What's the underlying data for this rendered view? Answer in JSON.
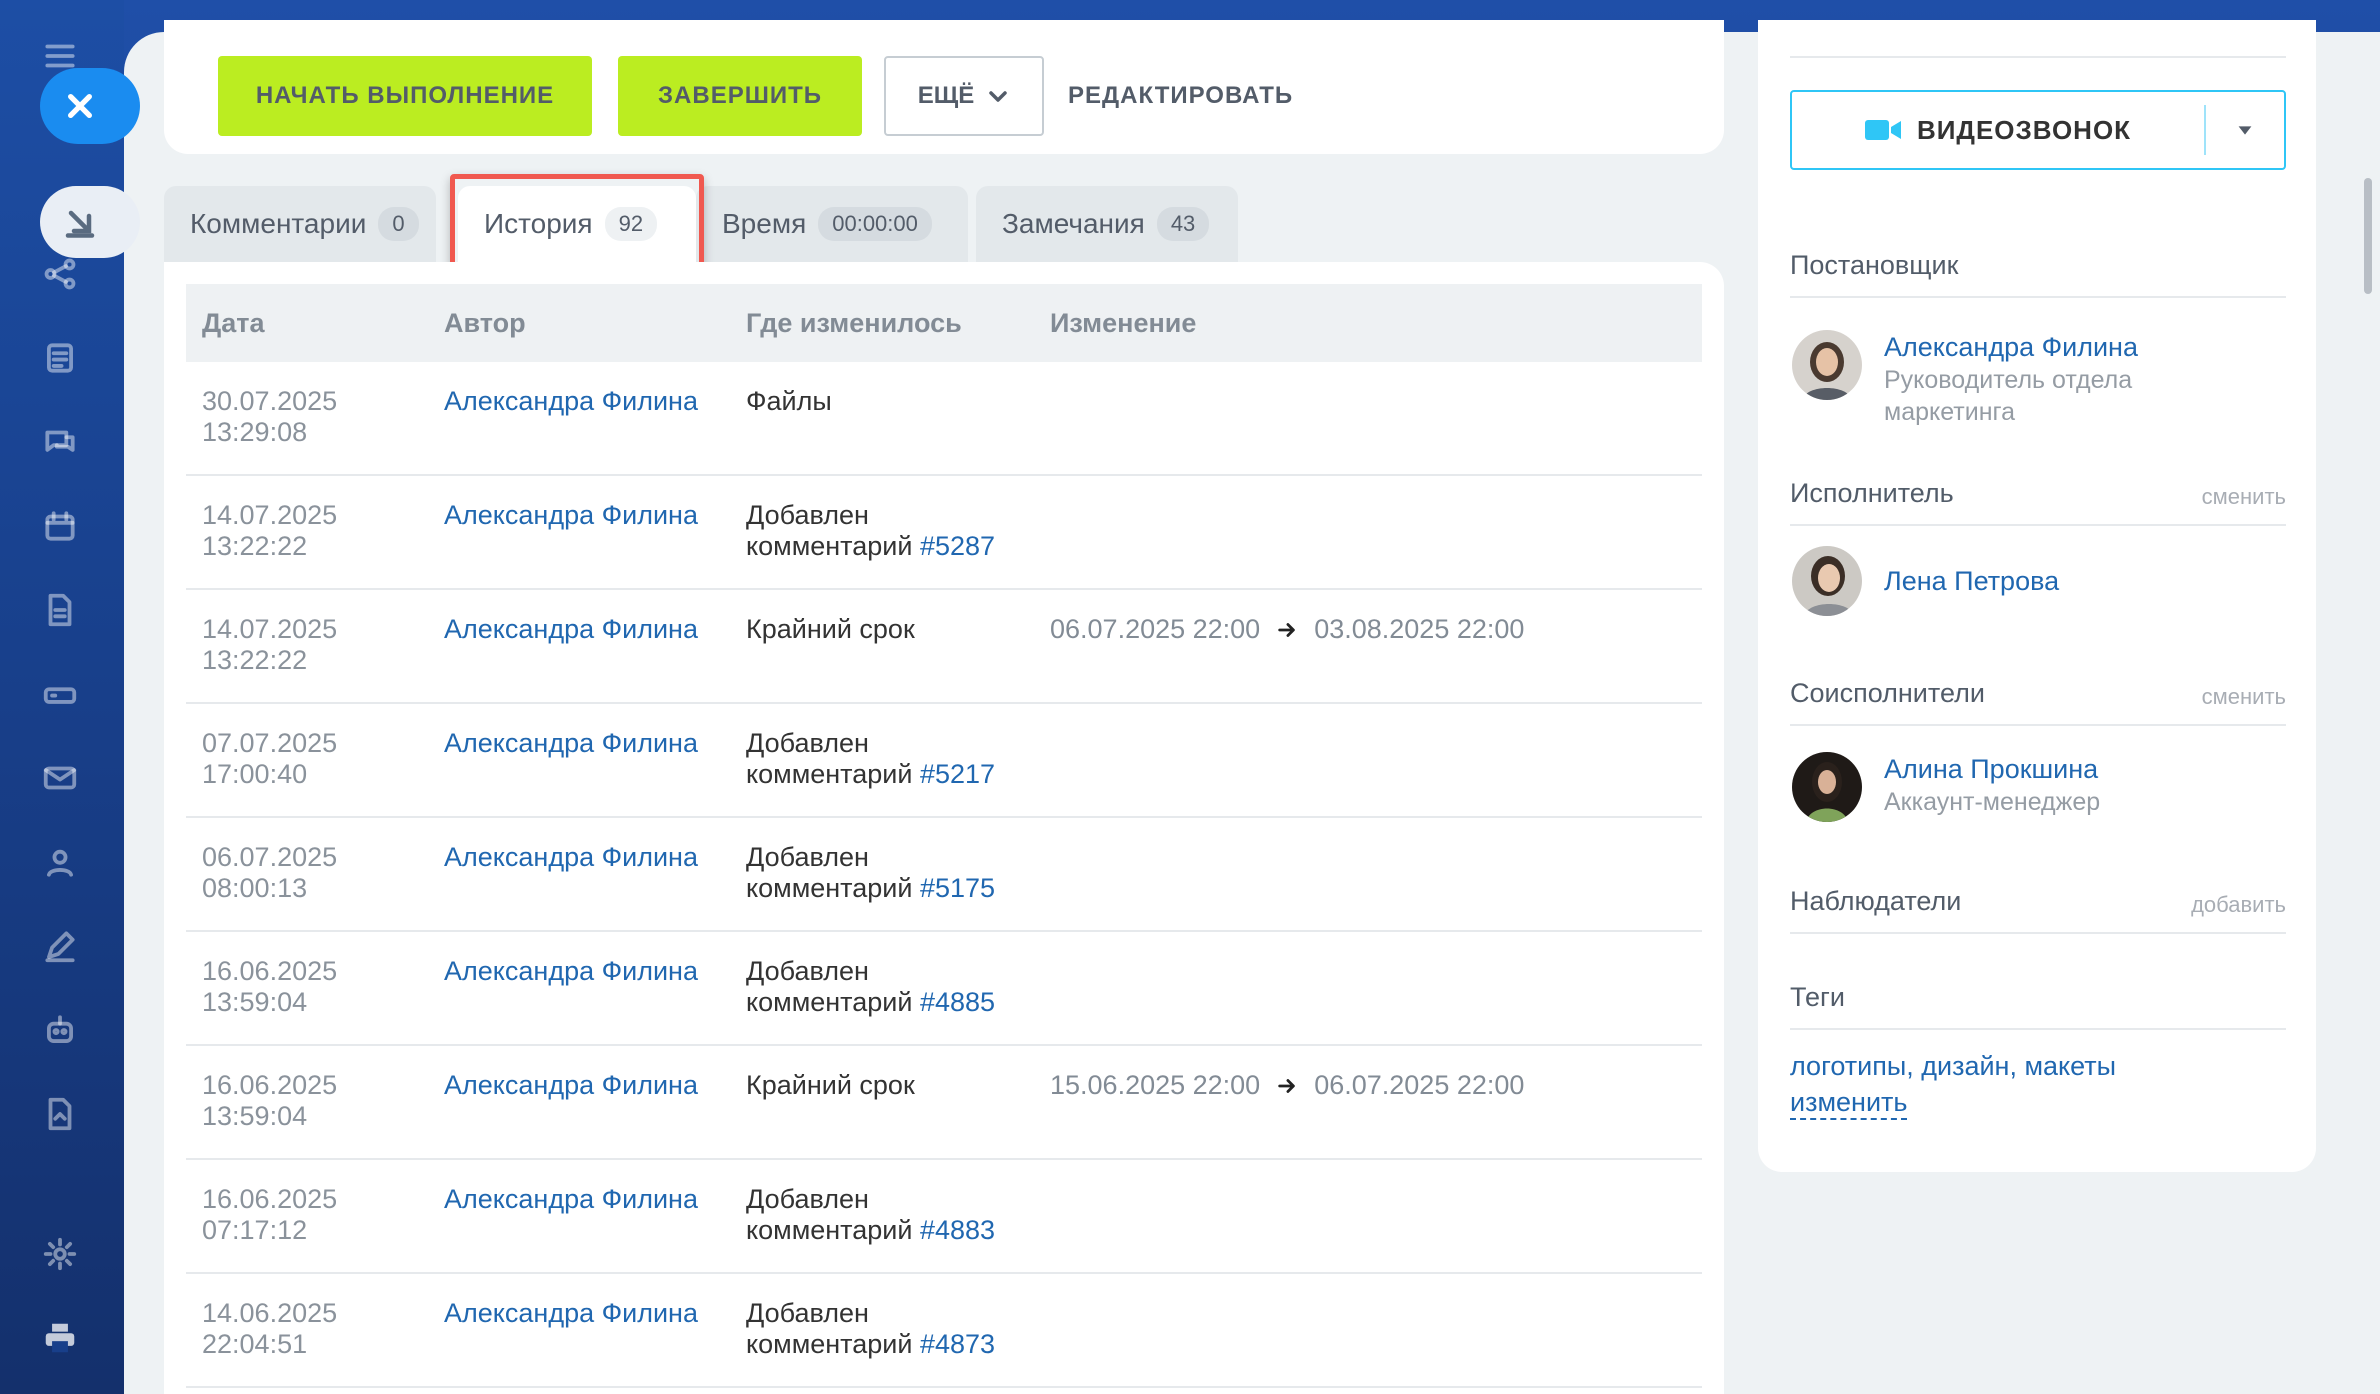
{
  "actions": {
    "start_label": "НАЧАТЬ ВЫПОЛНЕНИЕ",
    "finish_label": "ЗАВЕРШИТЬ",
    "more_label": "ЕЩЁ",
    "edit_label": "РЕДАКТИРОВАТЬ"
  },
  "tabs": [
    {
      "label": "Комментарии",
      "count": "0"
    },
    {
      "label": "История",
      "count": "92"
    },
    {
      "label": "Время",
      "count": "00:00:00"
    },
    {
      "label": "Замечания",
      "count": "43"
    }
  ],
  "table": {
    "headers": [
      "Дата",
      "Автор",
      "Где изменилось",
      "Изменение"
    ],
    "rows": [
      {
        "date": "30.07.2025",
        "time": "13:29:08",
        "author": "Александра Филина",
        "where": "Файлы",
        "link": "",
        "from": "",
        "to": ""
      },
      {
        "date": "14.07.2025",
        "time": "13:22:22",
        "author": "Александра Филина",
        "where": "Добавлен",
        "where2": "комментарий",
        "link": "#5287",
        "from": "",
        "to": ""
      },
      {
        "date": "14.07.2025",
        "time": "13:22:22",
        "author": "Александра Филина",
        "where": "Крайний срок",
        "link": "",
        "from": "06.07.2025 22:00",
        "to": "03.08.2025 22:00"
      },
      {
        "date": "07.07.2025",
        "time": "17:00:40",
        "author": "Александра Филина",
        "where": "Добавлен",
        "where2": "комментарий",
        "link": "#5217",
        "from": "",
        "to": ""
      },
      {
        "date": "06.07.2025",
        "time": "08:00:13",
        "author": "Александра Филина",
        "where": "Добавлен",
        "where2": "комментарий",
        "link": "#5175",
        "from": "",
        "to": ""
      },
      {
        "date": "16.06.2025",
        "time": "13:59:04",
        "author": "Александра Филина",
        "where": "Добавлен",
        "where2": "комментарий",
        "link": "#4885",
        "from": "",
        "to": ""
      },
      {
        "date": "16.06.2025",
        "time": "13:59:04",
        "author": "Александра Филина",
        "where": "Крайний срок",
        "link": "",
        "from": "15.06.2025 22:00",
        "to": "06.07.2025 22:00"
      },
      {
        "date": "16.06.2025",
        "time": "07:17:12",
        "author": "Александра Филина",
        "where": "Добавлен",
        "where2": "комментарий",
        "link": "#4883",
        "from": "",
        "to": ""
      },
      {
        "date": "14.06.2025",
        "time": "22:04:51",
        "author": "Александра Филина",
        "where": "Добавлен",
        "where2": "комментарий",
        "link": "#4873",
        "from": "",
        "to": ""
      }
    ]
  },
  "sidebar": {
    "video_label": "ВИДЕОЗВОНОК",
    "creator_title": "Постановщик",
    "creator": {
      "name": "Александра Филина",
      "role_line1": "Руководитель отдела",
      "role_line2": "маркетинга"
    },
    "assignee_title": "Исполнитель",
    "assignee_action": "сменить",
    "assignee": {
      "name": "Лена Петрова"
    },
    "coexec_title": "Соисполнители",
    "coexec_action": "сменить",
    "coexec": {
      "name": "Алина Прокшина",
      "role": "Аккаунт-менеджер"
    },
    "observers_title": "Наблюдатели",
    "observers_action": "добавить",
    "tags_title": "Теги",
    "tags_value": "логотипы, дизайн, макеты",
    "tags_edit": "изменить"
  },
  "colors": {
    "accent_green": "#bbed21",
    "link_blue": "#2067b0",
    "highlight_red": "#f0584f",
    "video_border": "#2fc6f6",
    "rail_blue": "#1d4ea5"
  }
}
